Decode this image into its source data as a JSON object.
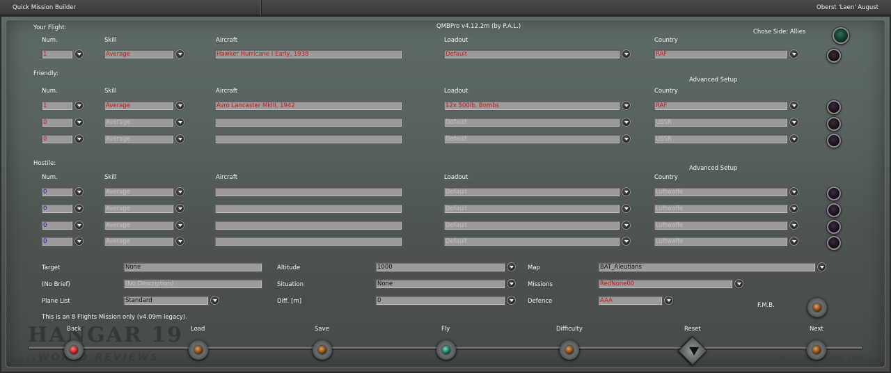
{
  "window": {
    "title": "Quick Mission Builder",
    "user": "Oberst  'Laen' August"
  },
  "version": "QMBPro v4.12.2m (by P.A.L.)",
  "side": {
    "label": "Chose Side: Allies"
  },
  "headers": {
    "num": "Num.",
    "skill": "Skill",
    "aircraft": "Aircraft",
    "loadout": "Loadout",
    "country": "Country",
    "advanced": "Advanced Setup"
  },
  "sections": {
    "your_flight": "Your Flight:",
    "friendly": "Friendly:",
    "hostile": "Hostile:"
  },
  "your_flight": {
    "num": "1",
    "skill": "Average",
    "aircraft": "Hawker Hurricane I Early, 1938",
    "loadout": "Default",
    "country": "RAF"
  },
  "friendly": [
    {
      "num": "1",
      "skill": "Average",
      "aircraft": "Avro Lancaster MkIII, 1942",
      "loadout": "12x 500lb. Bombs",
      "country": "RAF"
    },
    {
      "num": "0",
      "skill": "Average",
      "aircraft": "",
      "loadout": "Default",
      "country": "USSR"
    },
    {
      "num": "0",
      "skill": "Average",
      "aircraft": "",
      "loadout": "Default",
      "country": "USSR"
    }
  ],
  "hostile": [
    {
      "num": "0",
      "skill": "Average",
      "aircraft": "",
      "loadout": "Default",
      "country": "Luftwaffe"
    },
    {
      "num": "0",
      "skill": "Average",
      "aircraft": "",
      "loadout": "Default",
      "country": "Luftwaffe"
    },
    {
      "num": "0",
      "skill": "Average",
      "aircraft": "",
      "loadout": "Default",
      "country": "Luftwaffe"
    },
    {
      "num": "0",
      "skill": "Average",
      "aircraft": "",
      "loadout": "Default",
      "country": "Luftwaffe"
    }
  ],
  "settings": {
    "target_label": "Target",
    "target": "None",
    "brief_label": "(No Brief)",
    "brief": "(No Description)",
    "planelist_label": "Plane List",
    "planelist": "Standard",
    "altitude_label": "Altitude",
    "altitude": "1000",
    "situation_label": "Situation",
    "situation": "None",
    "diff_label": "Diff. [m]",
    "diff": "0",
    "map_label": "Map",
    "map": "BAT_Aleutians",
    "missions_label": "Missions",
    "missions": "RedNone00",
    "defence_label": "Defence",
    "defence": "AAA",
    "fmb_label": "F.M.B."
  },
  "note": "This is an 8 Flights Mission only (v4.09m legacy).",
  "buttons": {
    "back": "Back",
    "load": "Load",
    "save": "Save",
    "fly": "Fly",
    "difficulty": "Difficulty",
    "reset": "Reset",
    "next": "Next"
  },
  "branding": {
    "logo": "HANGAR 19",
    "logo_sub": "...WORLD REVIEWS",
    "watermark": "IL-2 STURMOVIK 1946"
  },
  "colors": {
    "red_text": "#d01818",
    "blue_text": "#1414c8",
    "back_button": "#c82020",
    "fly_button": "#2a9a7a",
    "amber_button": "#c87a20"
  }
}
